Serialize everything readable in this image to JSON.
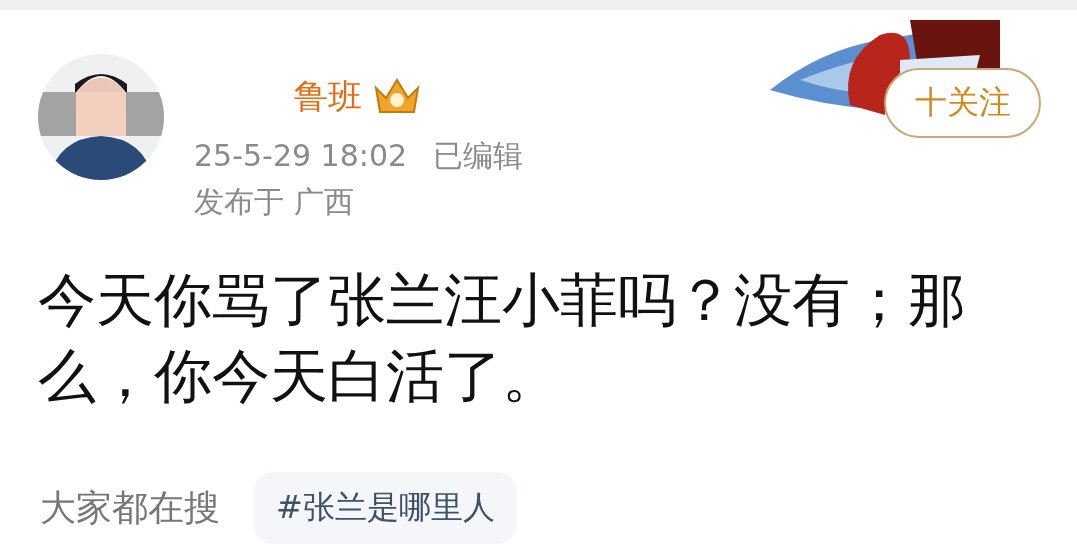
{
  "post": {
    "author": {
      "name": "鲁班",
      "verified": true
    },
    "follow_button": "十关注",
    "time": "25-5-29 18:02",
    "edited": "已编辑",
    "location": "发布于 广西",
    "text": "今天你骂了张兰汪小菲吗？没有；那么，你今天白活了。"
  },
  "trending": {
    "label": "大家都在搜",
    "tags": [
      "#张兰是哪里人"
    ]
  }
}
